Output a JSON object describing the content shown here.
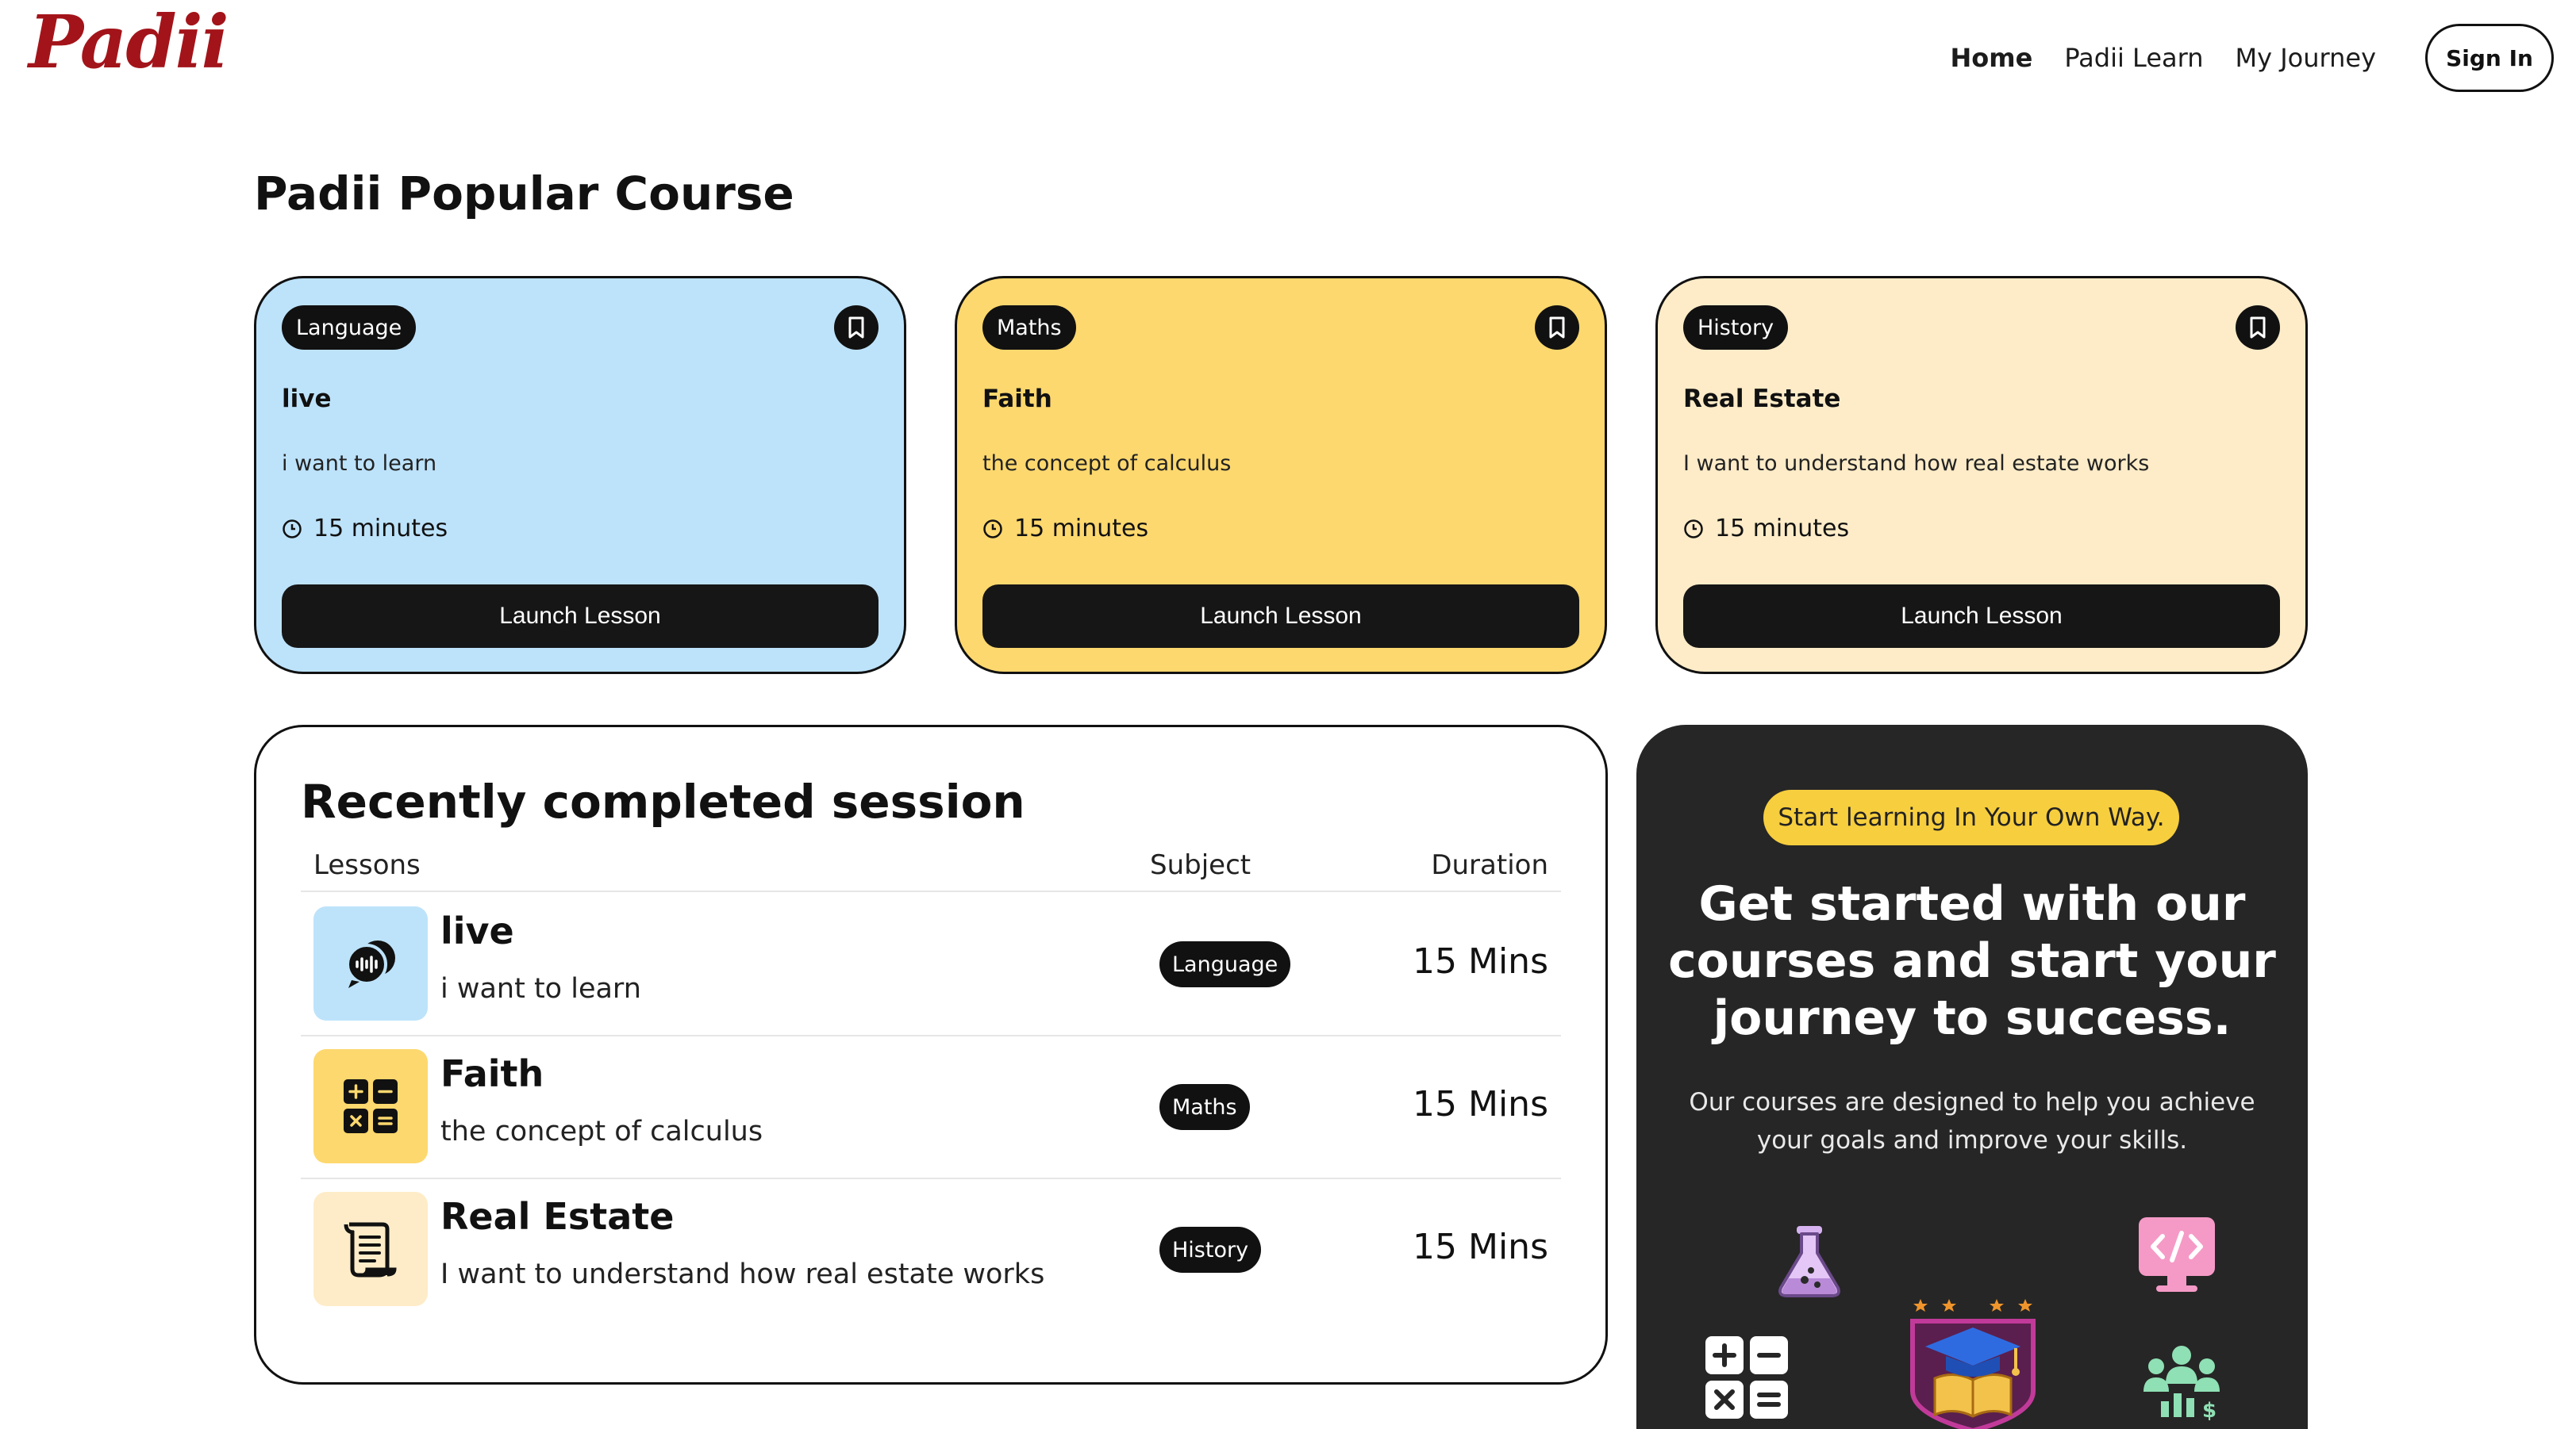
{
  "brand": {
    "logo_text": "Padii",
    "logo_color": "#a3141a"
  },
  "nav": {
    "items": [
      {
        "label": "Home",
        "active": true
      },
      {
        "label": "Padii Learn",
        "active": false
      },
      {
        "label": "My Journey",
        "active": false
      }
    ],
    "signin_label": "Sign In"
  },
  "popular": {
    "title": "Padii Popular Course",
    "cards": [
      {
        "badge": "Language",
        "title": "live",
        "description": "i want to learn",
        "duration": "15 minutes",
        "button": "Launch Lesson",
        "color": "#bde3fb",
        "icon": "bookmark-icon"
      },
      {
        "badge": "Maths",
        "title": "Faith",
        "description": "the concept of calculus",
        "duration": "15 minutes",
        "button": "Launch Lesson",
        "color": "#fdd86e",
        "icon": "bookmark-icon"
      },
      {
        "badge": "History",
        "title": "Real Estate",
        "description": "I want to understand how real estate works",
        "duration": "15 minutes",
        "button": "Launch Lesson",
        "color": "#feecc8",
        "icon": "bookmark-icon"
      }
    ]
  },
  "recent": {
    "title": "Recently completed session",
    "columns": {
      "lessons": "Lessons",
      "subject": "Subject",
      "duration": "Duration"
    },
    "rows": [
      {
        "title": "live",
        "description": "i want to learn",
        "subject": "Language",
        "duration": "15 Mins",
        "icon": "voice-chat-icon",
        "thumb_color": "#bde3fb"
      },
      {
        "title": "Faith",
        "description": "the concept of calculus",
        "subject": "Maths",
        "duration": "15 Mins",
        "icon": "calculator-icon",
        "thumb_color": "#fdd86e"
      },
      {
        "title": "Real Estate",
        "description": "I want to understand how real estate works",
        "subject": "History",
        "duration": "15 Mins",
        "icon": "scroll-icon",
        "thumb_color": "#feecc8"
      }
    ]
  },
  "promo": {
    "pill": "Start learning In Your Own Way.",
    "headline": "Get started with our courses and start your journey to success.",
    "subtext": "Our courses are designed to help you achieve your goals and improve your skills.",
    "icons": [
      "flask-icon",
      "code-monitor-icon",
      "calculator-icon",
      "graduation-book-badge-icon",
      "team-growth-icon"
    ],
    "colors": {
      "background": "#262626",
      "pill": "#f7ce3e"
    }
  }
}
